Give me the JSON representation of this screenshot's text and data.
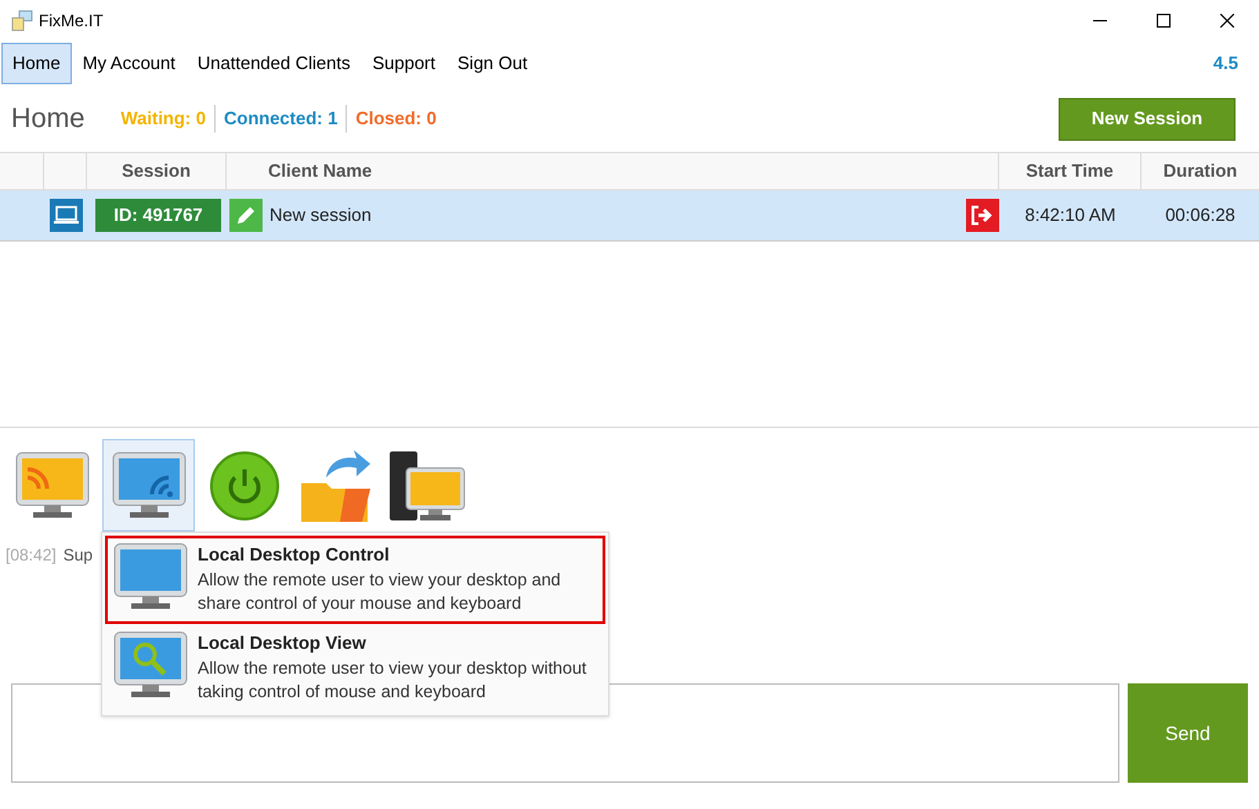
{
  "window": {
    "title": "FixMe.IT"
  },
  "menu": [
    {
      "label": "Home",
      "selected": true
    },
    {
      "label": "My Account",
      "selected": false
    },
    {
      "label": "Unattended Clients",
      "selected": false
    },
    {
      "label": "Support",
      "selected": false
    },
    {
      "label": "Sign Out",
      "selected": false
    }
  ],
  "version": "4.5",
  "header": {
    "title": "Home",
    "stats": [
      {
        "label": "Waiting: 0",
        "color": "#f2b500"
      },
      {
        "label": "Connected: 1",
        "color": "#1e8bc3"
      },
      {
        "label": "Closed: 0",
        "color": "#f26b2a"
      }
    ],
    "new_session_button": "New Session"
  },
  "table": {
    "columns": [
      "Session",
      "Client Name",
      "Start Time",
      "Duration"
    ],
    "rows": [
      {
        "selected": true,
        "session_id": "ID: 491767",
        "client_name": "New session",
        "start_time": "8:42:10 AM",
        "duration": "00:06:28"
      }
    ]
  },
  "toolbar": [
    {
      "kind": "stream",
      "selected": false
    },
    {
      "kind": "share",
      "selected": true
    },
    {
      "kind": "power",
      "selected": false
    },
    {
      "kind": "files",
      "selected": false
    },
    {
      "kind": "computer",
      "selected": false
    }
  ],
  "chat_log": [
    {
      "time": "[08:42]",
      "text": "Sup"
    }
  ],
  "dropdown": [
    {
      "kind": "control",
      "title": "Local Desktop Control",
      "description": "Allow the remote user to view your desktop and share control of your mouse and keyboard",
      "selected": true
    },
    {
      "kind": "view",
      "title": "Local Desktop View",
      "description": "Allow the remote user to view your desktop without taking control of mouse and keyboard",
      "selected": false
    }
  ],
  "send_button": "Send"
}
